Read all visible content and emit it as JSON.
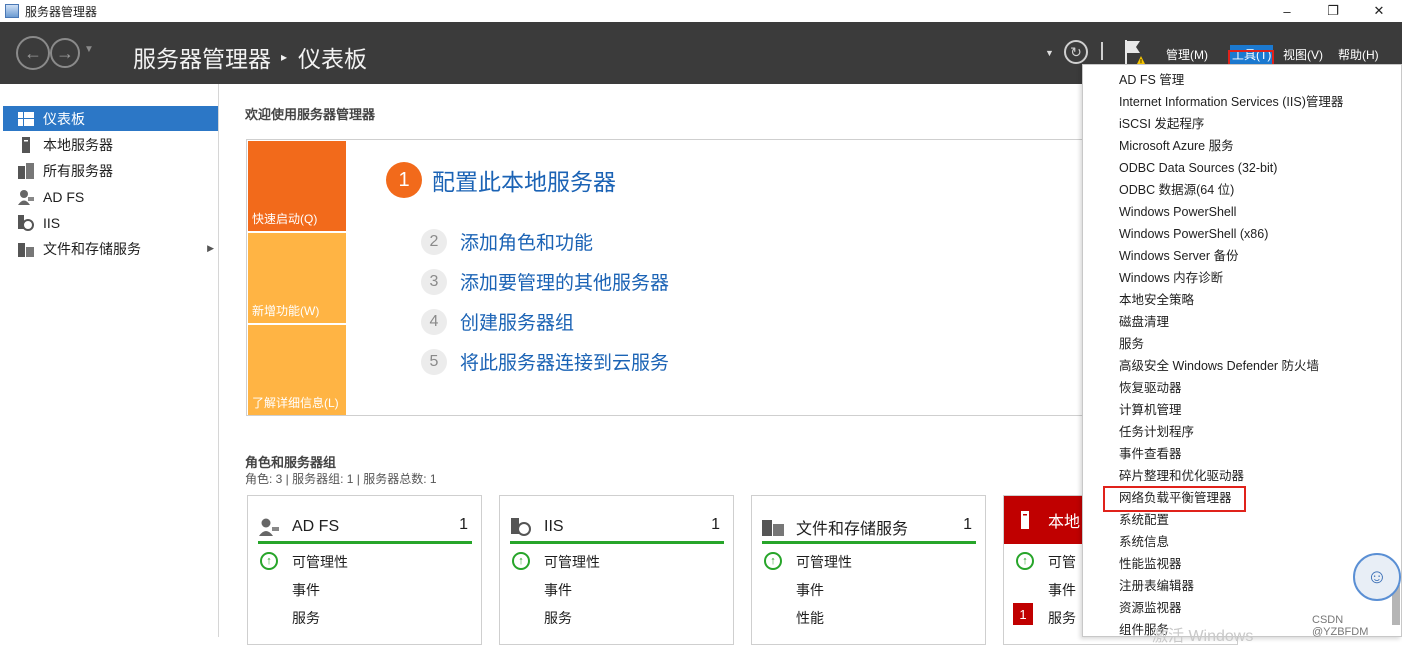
{
  "window": {
    "title": "服务器管理器",
    "minimize": "–",
    "restore": "❐",
    "close": "✕"
  },
  "header": {
    "breadcrumb_root": "服务器管理器",
    "breadcrumb_sep": "▸",
    "breadcrumb_page": "仪表板",
    "menus": {
      "manage": "管理(M)",
      "tools": "工具(T)",
      "view": "视图(V)",
      "help": "帮助(H)"
    }
  },
  "sidebar": {
    "items": [
      {
        "label": "仪表板",
        "icon": "dashboard-icon"
      },
      {
        "label": "本地服务器",
        "icon": "server-icon"
      },
      {
        "label": "所有服务器",
        "icon": "servers-icon"
      },
      {
        "label": "AD FS",
        "icon": "adfs-icon"
      },
      {
        "label": "IIS",
        "icon": "iis-icon"
      },
      {
        "label": "文件和存储服务",
        "icon": "file-storage-icon"
      }
    ]
  },
  "welcome": {
    "title": "欢迎使用服务器管理器",
    "tiles": {
      "quick_start": "快速启动(Q)",
      "whats_new": "新增功能(W)",
      "learn_more": "了解详细信息(L)"
    },
    "step1": {
      "num": "1",
      "text": "配置此本地服务器"
    },
    "steps": [
      {
        "num": "2",
        "text": "添加角色和功能"
      },
      {
        "num": "3",
        "text": "添加要管理的其他服务器"
      },
      {
        "num": "4",
        "text": "创建服务器组"
      },
      {
        "num": "5",
        "text": "将此服务器连接到云服务"
      }
    ]
  },
  "roles": {
    "title": "角色和服务器组",
    "subtitle": "角色: 3 | 服务器组: 1 | 服务器总数: 1",
    "cards": [
      {
        "name": "AD FS",
        "count": "1",
        "rows": [
          "可管理性",
          "事件",
          "服务"
        ]
      },
      {
        "name": "IIS",
        "count": "1",
        "rows": [
          "可管理性",
          "事件",
          "服务"
        ]
      },
      {
        "name": "文件和存储服务",
        "count": "1",
        "rows": [
          "可管理性",
          "事件",
          "性能"
        ]
      },
      {
        "name": "本地",
        "count": "",
        "rows": [
          "可管",
          "事件",
          "服务"
        ],
        "badge": "1"
      }
    ]
  },
  "tools_menu": {
    "items": [
      "AD FS 管理",
      "Internet Information Services (IIS)管理器",
      "iSCSI 发起程序",
      "Microsoft Azure 服务",
      "ODBC Data Sources (32-bit)",
      "ODBC 数据源(64 位)",
      "Windows PowerShell",
      "Windows PowerShell (x86)",
      "Windows Server 备份",
      "Windows 内存诊断",
      "本地安全策略",
      "磁盘清理",
      "服务",
      "高级安全 Windows Defender 防火墙",
      "恢复驱动器",
      "计算机管理",
      "任务计划程序",
      "事件查看器",
      "碎片整理和优化驱动器",
      "网络负载平衡管理器",
      "系统配置",
      "系统信息",
      "性能监视器",
      "注册表编辑器",
      "资源监视器",
      "组件服务"
    ],
    "highlighted": "网络负载平衡管理器"
  },
  "overlay": {
    "watermark": "CSDN @YZBFDM",
    "activate": "激活 Windows"
  }
}
